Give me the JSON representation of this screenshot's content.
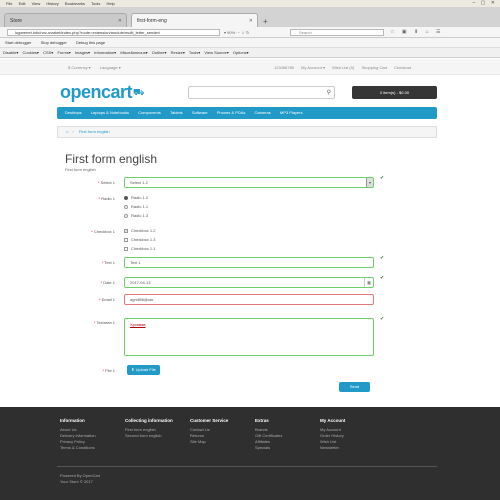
{
  "browser": {
    "menu": [
      "File",
      "Edit",
      "View",
      "History",
      "Bookmarks",
      "Tools",
      "Help"
    ],
    "tabs": [
      {
        "label": "Store"
      },
      {
        "label": "first-form-eng"
      }
    ],
    "url": "lugarenet.info/nov-market/index.php?route=extension/module/multi_letter_sender/",
    "zoom": "90%",
    "search_placeholder": "Search",
    "debug": [
      "Start debugger",
      "Stop debugger",
      "Debug this page"
    ],
    "devtools": [
      "Disable▾",
      "Cookies▾",
      "CSS▾",
      "Forms▾",
      "Images▾",
      "Information▾",
      "Miscellaneous▾",
      "Outline▾",
      "Resize▾",
      "Tools▾",
      "View Source▾",
      "Options▾"
    ]
  },
  "store": {
    "currency": "$ Currency ▾",
    "language": "Language ▾",
    "phone": "123456789",
    "account": "My Account ▾",
    "wishlist": "Wish List (0)",
    "cart_link": "Shopping Cart",
    "checkout": "Checkout",
    "logo": "opencart",
    "cart_button": "0 item(s) - $0.00",
    "nav": [
      "Desktops",
      "Laptops & Notebooks",
      "Components",
      "Tablets",
      "Software",
      "Phones & PDAs",
      "Cameras",
      "MP3 Players"
    ],
    "breadcrumb": "First form english"
  },
  "form": {
    "title": "First form english",
    "subtitle": "First form english",
    "select_label": "Select 1",
    "select_value": "Select 1.2",
    "radio_label": "Radio 1",
    "radios": [
      "Radio 1.2",
      "Radio 1.1",
      "Radio 1.3"
    ],
    "checkbox_label": "Checkbox 1",
    "checkboxes": [
      "Checkbox 1.2",
      "Checkbox 1.3",
      "Checkbox 1.1"
    ],
    "text_label": "Text 1",
    "text_value": "Text 1",
    "date_label": "Date 1",
    "date_value": "2017-04-13",
    "email_label": "Email 1",
    "email_value": "agmll56@ukr",
    "textarea_label": "Textarea 1",
    "textarea_value": "Хрхнвав",
    "file_label": "File 1",
    "upload_label": "Upload File",
    "send_label": "Send"
  },
  "footer": {
    "columns": [
      {
        "heading": "Information",
        "links": [
          "About Us",
          "Delivery Information",
          "Privacy Policy",
          "Terms & Conditions"
        ]
      },
      {
        "heading": "Collecting information",
        "links": [
          "First form english",
          "Second form english"
        ]
      },
      {
        "heading": "Customer Service",
        "links": [
          "Contact Us",
          "Returns",
          "Site Map"
        ]
      },
      {
        "heading": "Extras",
        "links": [
          "Brands",
          "Gift Certificates",
          "Affiliates",
          "Specials"
        ]
      },
      {
        "heading": "My Account",
        "links": [
          "My Account",
          "Order History",
          "Wish List",
          "Newsletter"
        ]
      }
    ],
    "powered": "Powered By OpenCart",
    "store_line": "Your Store © 2017"
  }
}
